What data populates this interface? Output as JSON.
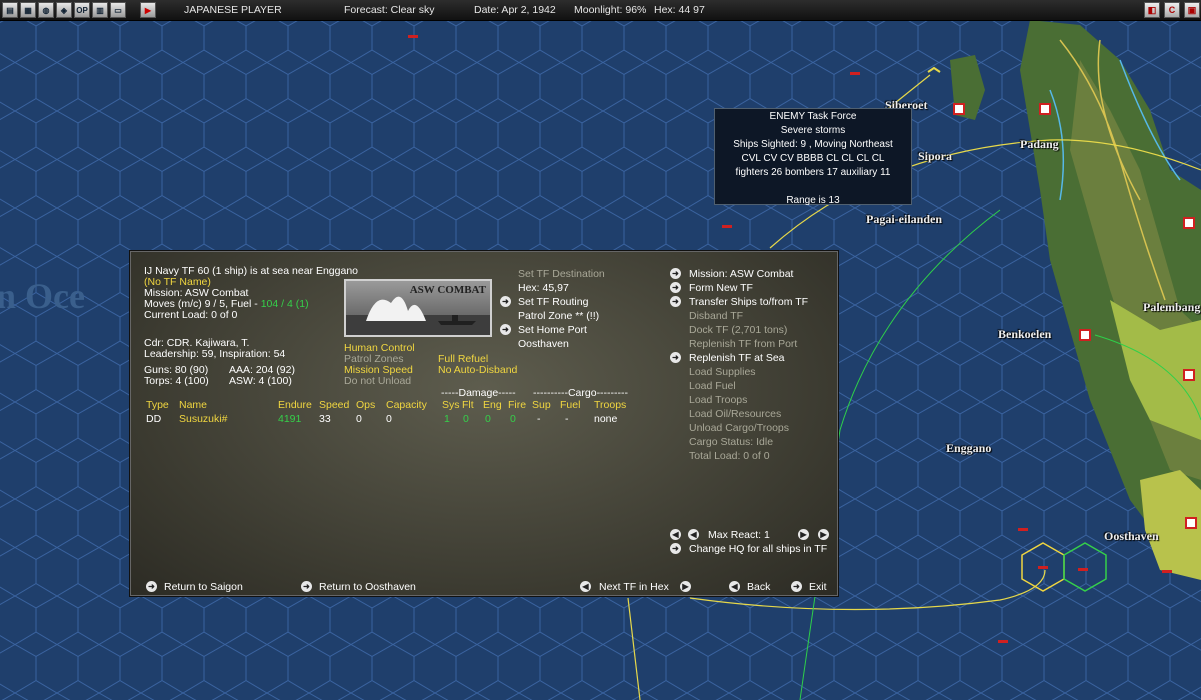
{
  "topbar": {
    "player": "JAPANESE PLAYER",
    "forecast": "Forecast: Clear sky",
    "date": "Date: Apr 2, 1942",
    "moonlight": "Moonlight: 96%",
    "hex": "Hex: 44 97",
    "icons": [
      "save-icon",
      "map-icon",
      "globe-icon",
      "filter-icon",
      "op-icon",
      "grid-icon",
      "window-icon",
      "end-turn-icon"
    ],
    "op_label": "OP"
  },
  "map": {
    "labels": [
      "Siberoet",
      "Sipora",
      "Pagai-eilanden",
      "Padang",
      "Palembang",
      "Benkoelen",
      "Enggano",
      "Oosthaven"
    ],
    "ocean_label": "n Oce"
  },
  "tooltip": {
    "lines": [
      "ENEMY Task Force",
      "Severe storms",
      "Ships Sighted: 9 , Moving Northeast",
      "CVL CV CV BBBB CL CL CL CL",
      "fighters 26  bombers 17  auxiliary 11",
      "",
      "Range is 13"
    ]
  },
  "tf": {
    "title": "IJ Navy TF 60 (1 ship) is at sea near Enggano",
    "name": "(No TF Name)",
    "mission": "Mission:  ASW Combat",
    "moves": "Moves (m/c) 9 / 5, Fuel - ",
    "fuel": "104 / 4 (1)",
    "load": "Current Load:  0 of 0",
    "cdr": "Cdr: CDR. Kajiwara, T.",
    "leadership": "Leadership: 59, Inspiration: 54",
    "guns": "Guns: 80 (90)",
    "aaa": "AAA: 204 (92)",
    "torps": "Torps: 4 (100)",
    "asw": "ASW: 4 (100)",
    "image_caption": "ASW COMBAT",
    "human_control": "Human Control",
    "patrol_zones": "Patrol Zones",
    "full_refuel": "Full Refuel",
    "mission_speed": "Mission Speed",
    "no_auto_disband": "No Auto-Disband",
    "do_not_unload": "Do not Unload"
  },
  "destination": {
    "set_dest": "Set TF Destination",
    "hex": "Hex: 45,97",
    "set_routing": "Set TF Routing",
    "patrol_zone": "Patrol Zone ** (!!)",
    "set_home": "Set Home Port",
    "home": "Oosthaven"
  },
  "commands": {
    "mission": "Mission: ASW Combat",
    "form_new": "Form New TF",
    "transfer": "Transfer Ships to/from TF",
    "disband": "Disband TF",
    "dock": "Dock TF (2,701 tons)",
    "replenish_port": "Replenish TF from Port",
    "replenish_sea": "Replenish TF at Sea",
    "load_supplies": "Load Supplies",
    "load_fuel": "Load Fuel",
    "load_troops": "Load Troops",
    "load_oil": "Load Oil/Resources",
    "unload": "Unload Cargo/Troops",
    "cargo_status": "Cargo Status: Idle",
    "total_load": "Total Load: 0 of 0",
    "max_react": "Max React:  1",
    "change_hq": "Change HQ for all ships in TF"
  },
  "table": {
    "group_damage": "-----Damage-----",
    "group_cargo": "----------Cargo---------",
    "headers": [
      "Type",
      "Name",
      "Endure",
      "Speed",
      "Ops",
      "Capacity",
      "Sys",
      "Flt",
      "Eng",
      "Fire",
      "Sup",
      "Fuel",
      "Troops"
    ],
    "rows": [
      [
        "DD",
        "Susuzuki#",
        "4191",
        "33",
        "0",
        "0",
        "1",
        "0",
        "0",
        "0",
        "-",
        "-",
        "none"
      ]
    ]
  },
  "footer": {
    "return_saigon": "Return to Saigon",
    "return_oosthaven": "Return to Oosthaven",
    "next_tf": "Next TF in Hex",
    "back": "Back",
    "exit": "Exit"
  },
  "colors": {
    "ocean": "#1f3f6c",
    "hex_lines": "#2f5688",
    "land": "#2e5a2a",
    "yellow": "#f0d640",
    "green": "#35d04a",
    "panel": "#4d4c40"
  }
}
